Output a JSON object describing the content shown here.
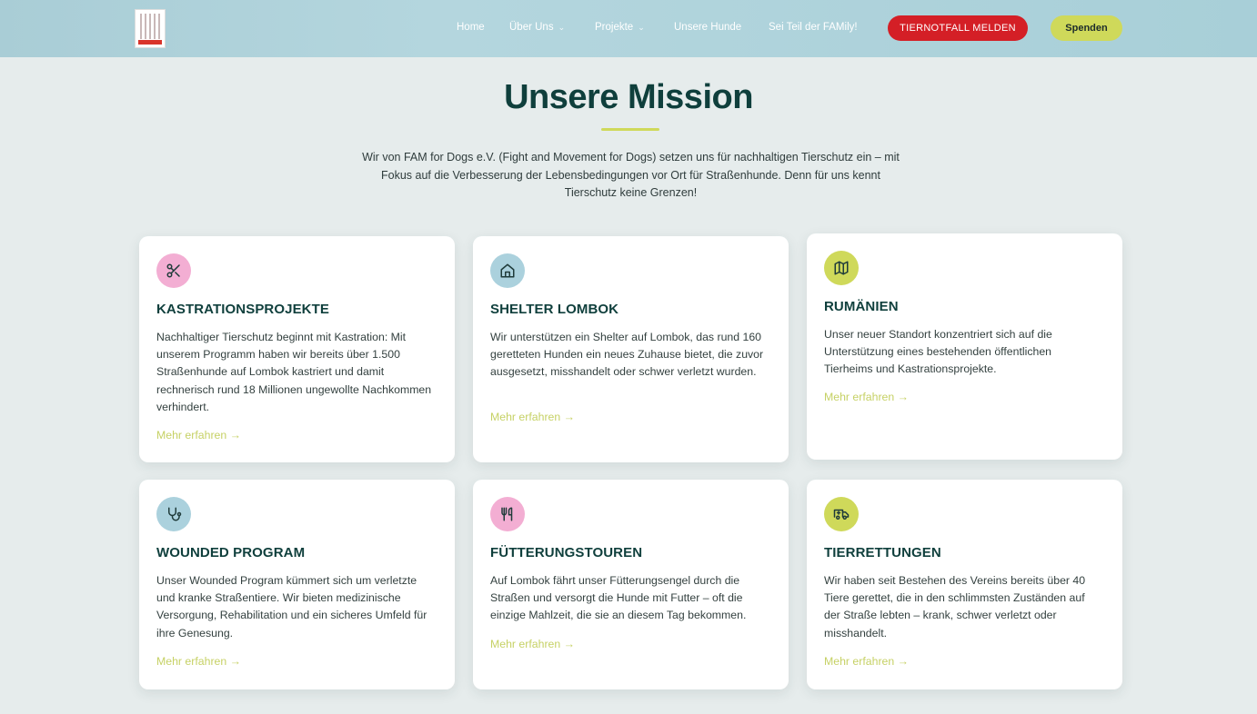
{
  "header": {
    "logo_icon": "fam-for-dogs-logo",
    "nav": [
      {
        "label": "Home",
        "has_dropdown": false
      },
      {
        "label": "Über Uns",
        "has_dropdown": true
      },
      {
        "label": "Projekte",
        "has_dropdown": true
      },
      {
        "label": "Unsere Hunde",
        "has_dropdown": false
      },
      {
        "label": "Sei Teil der FAMily!",
        "has_dropdown": false
      }
    ],
    "emergency_button": "TIERNOTFALL MELDEN",
    "donate_button": "Spenden"
  },
  "mission": {
    "title": "Unsere Mission",
    "intro": "Wir von FAM for Dogs e.V. (Fight and Movement for Dogs) setzen uns für nachhaltigen Tierschutz ein – mit Fokus auf die Verbesserung der Lebensbedingungen vor Ort für Straßenhunde. Denn für uns kennt Tierschutz keine Grenzen!"
  },
  "cards": [
    {
      "icon": "scissors-icon",
      "title": "KASTRATIONSPROJEKTE",
      "text": "Nachhaltiger Tierschutz beginnt mit Kastration: Mit unserem Programm haben wir bereits über 1.500 Straßenhunde auf Lombok kastriert und damit rechnerisch rund 18 Millionen ungewollte Nachkommen verhindert.",
      "link": "Mehr erfahren →"
    },
    {
      "icon": "house-icon",
      "title": "SHELTER LOMBOK",
      "text": "Wir unterstützen ein Shelter auf Lombok, das rund 160 geretteten Hunden ein neues Zuhause bietet, die zuvor ausgesetzt, misshandelt oder schwer verletzt wurden.",
      "link": "Mehr erfahren →"
    },
    {
      "icon": "map-icon",
      "title": "RUMÄNIEN",
      "text": "Unser neuer Standort konzentriert sich auf die Unterstützung eines bestehenden öffentlichen Tierheims und Kastrationsprojekte.",
      "link": "Mehr erfahren →"
    },
    {
      "icon": "stethoscope-icon",
      "title": "WOUNDED PROGRAM",
      "text": "Unser Wounded Program kümmert sich um verletzte und kranke Straßentiere. Wir bieten medizinische Versorgung, Rehabilitation und ein sicheres Umfeld für ihre Genesung.",
      "link": "Mehr erfahren →"
    },
    {
      "icon": "utensils-icon",
      "title": "FÜTTERUNGSTOUREN",
      "text": "Auf Lombok fährt unser Fütterungsengel durch die Straßen und versorgt die Hunde mit Futter – oft die einzige Mahlzeit, die sie an diesem Tag bekommen.",
      "link": "Mehr erfahren →"
    },
    {
      "icon": "ambulance-icon",
      "title": "TIERRETTUNGEN",
      "text": "Wir haben seit Bestehen des Vereins bereits über 40 Tiere gerettet, die in den schlimmsten Zuständen auf der Straße lebten – krank, schwer verletzt oder misshandelt.",
      "link": "Mehr erfahren →"
    }
  ],
  "colors": {
    "brand_dark": "#0f3f3c",
    "accent_lime": "#cfd95a",
    "emergency_red": "#d41f26",
    "icon_pink": "#f3aed3",
    "icon_blue": "#abd1dd"
  }
}
